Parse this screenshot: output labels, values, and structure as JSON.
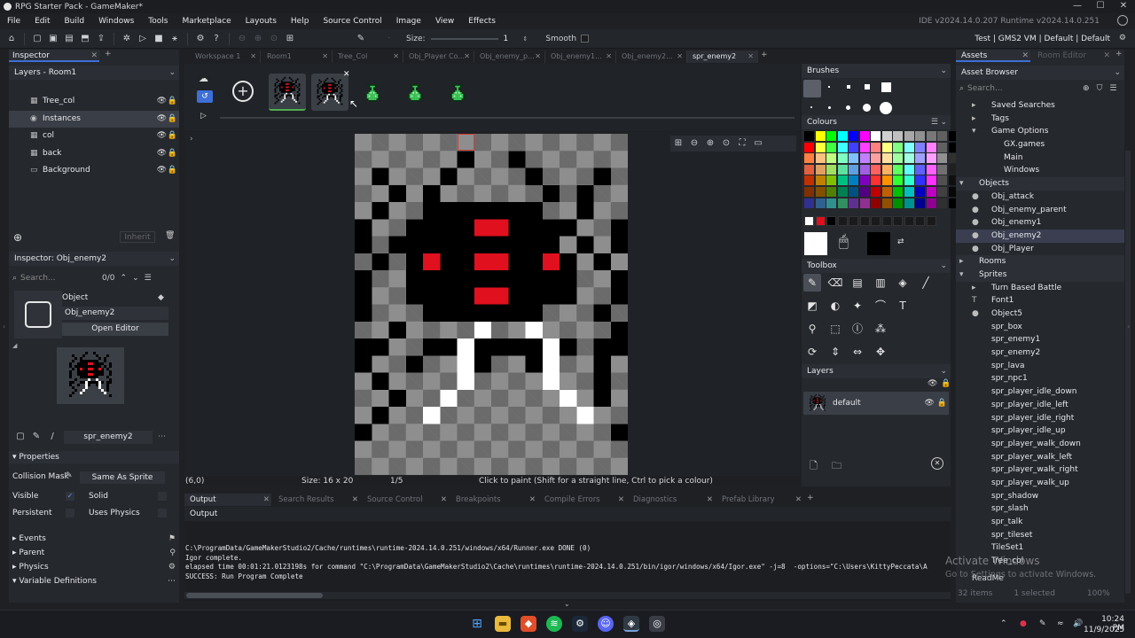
{
  "window": {
    "title": "RPG Starter Pack - GameMaker*",
    "min": "—",
    "max": "☐",
    "close": "✕"
  },
  "menu": {
    "items": [
      "File",
      "Edit",
      "Build",
      "Windows",
      "Tools",
      "Marketplace",
      "Layouts",
      "Help",
      "Source Control",
      "Image",
      "View",
      "Effects"
    ],
    "version": "IDE v2024.14.0.207  Runtime v2024.14.0.251"
  },
  "toolbar": {
    "size_label": "Size:",
    "size_value": "1",
    "smooth_label": "Smooth",
    "config": "Test  |  GMS2 VM  |  Default  |  Default"
  },
  "inspector": {
    "title": "Inspector",
    "layers_header": "Layers - Room1",
    "layers": [
      {
        "name": "Tree_col",
        "icon": "tile-layer-icon",
        "glyph": "▦"
      },
      {
        "name": "Instances",
        "icon": "instance-layer-icon",
        "glyph": "◉"
      },
      {
        "name": "col",
        "icon": "tile-layer-icon",
        "glyph": "▦"
      },
      {
        "name": "back",
        "icon": "tile-layer-icon",
        "glyph": "▦"
      },
      {
        "name": "Background",
        "icon": "background-layer-icon",
        "glyph": "▭"
      }
    ],
    "inherit": "Inherit",
    "obj_header": "Inspector: Obj_enemy2",
    "search_placeholder": "Search...",
    "search_count": "0/0",
    "object_label": "Object",
    "object_name": "Obj_enemy2",
    "open_editor": "Open Editor",
    "sprite_name": "spr_enemy2",
    "properties": "Properties",
    "collision_mask": "Collision Mask",
    "same_as_sprite": "Same As Sprite",
    "visible": "Visible",
    "solid": "Solid",
    "persistent": "Persistent",
    "uses_physics": "Uses Physics",
    "sections": [
      "Events",
      "Parent",
      "Physics",
      "Variable Definitions"
    ]
  },
  "tabs": [
    {
      "label": "Workspace 1",
      "active": false
    },
    {
      "label": "Room1",
      "active": false
    },
    {
      "label": "Tree_Col",
      "active": false
    },
    {
      "label": "Obj_Player Co...",
      "active": false
    },
    {
      "label": "Obj_enemy_p...",
      "active": false
    },
    {
      "label": "Obj_enemy1...",
      "active": false
    },
    {
      "label": "Obj_enemy2...",
      "active": false
    },
    {
      "label": "spr_enemy2",
      "active": true
    }
  ],
  "status": {
    "coords": "(6,0)",
    "size": "Size: 16 x 20",
    "frame": "1/5",
    "hint": "Click to paint (Shift for a straight line, Ctrl to pick a colour)"
  },
  "brushes": {
    "title": "Brushes"
  },
  "colours": {
    "title": "Colours"
  },
  "toolbox": {
    "title": "Toolbox"
  },
  "layers_panel": {
    "title": "Layers",
    "layer": "default"
  },
  "assets": {
    "title": "Assets",
    "room_editor_tab": "Room Editor",
    "browser": "Asset Browser",
    "search_placeholder": "Search...",
    "tree": [
      {
        "label": "Saved Searches",
        "indent": 1,
        "arrow": "▸"
      },
      {
        "label": "Tags",
        "indent": 1,
        "arrow": "▸"
      },
      {
        "label": "Game Options",
        "indent": 1,
        "arrow": "▾"
      },
      {
        "label": "GX.games",
        "indent": 2,
        "arrow": ""
      },
      {
        "label": "Main",
        "indent": 2,
        "arrow": ""
      },
      {
        "label": "Windows",
        "indent": 2,
        "arrow": ""
      },
      {
        "label": "Objects",
        "indent": 0,
        "arrow": "▾",
        "folder": true
      },
      {
        "label": "Obj_attack",
        "indent": 1,
        "arrow": "●"
      },
      {
        "label": "Obj_enemy_parent",
        "indent": 1,
        "arrow": "●"
      },
      {
        "label": "Obj_enemy1",
        "indent": 1,
        "arrow": "●"
      },
      {
        "label": "Obj_enemy2",
        "indent": 1,
        "arrow": "●",
        "selected": true
      },
      {
        "label": "Obj_Player",
        "indent": 1,
        "arrow": "●"
      },
      {
        "label": "Rooms",
        "indent": 0,
        "arrow": "▸",
        "folder": true
      },
      {
        "label": "Sprites",
        "indent": 0,
        "arrow": "▾",
        "folder": true
      },
      {
        "label": "Turn Based Battle",
        "indent": 1,
        "arrow": "▸"
      },
      {
        "label": "Font1",
        "indent": 1,
        "arrow": "T"
      },
      {
        "label": "Object5",
        "indent": 1,
        "arrow": "●"
      },
      {
        "label": "spr_box",
        "indent": 1,
        "arrow": ""
      },
      {
        "label": "spr_enemy1",
        "indent": 1,
        "arrow": ""
      },
      {
        "label": "spr_enemy2",
        "indent": 1,
        "arrow": ""
      },
      {
        "label": "spr_lava",
        "indent": 1,
        "arrow": ""
      },
      {
        "label": "spr_npc1",
        "indent": 1,
        "arrow": ""
      },
      {
        "label": "spr_player_idle_down",
        "indent": 1,
        "arrow": ""
      },
      {
        "label": "spr_player_idle_left",
        "indent": 1,
        "arrow": ""
      },
      {
        "label": "spr_player_idle_right",
        "indent": 1,
        "arrow": ""
      },
      {
        "label": "spr_player_idle_up",
        "indent": 1,
        "arrow": ""
      },
      {
        "label": "spr_player_walk_down",
        "indent": 1,
        "arrow": ""
      },
      {
        "label": "spr_player_walk_left",
        "indent": 1,
        "arrow": ""
      },
      {
        "label": "spr_player_walk_right",
        "indent": 1,
        "arrow": ""
      },
      {
        "label": "spr_player_walk_up",
        "indent": 1,
        "arrow": ""
      },
      {
        "label": "spr_shadow",
        "indent": 1,
        "arrow": ""
      },
      {
        "label": "spr_slash",
        "indent": 1,
        "arrow": ""
      },
      {
        "label": "spr_talk",
        "indent": 1,
        "arrow": ""
      },
      {
        "label": "spr_tileset",
        "indent": 1,
        "arrow": ""
      },
      {
        "label": "TileSet1",
        "indent": 1,
        "arrow": ""
      },
      {
        "label": "Tree_col",
        "indent": 1,
        "arrow": ""
      }
    ],
    "footer_items": "32 items",
    "footer_selected": "1 selected",
    "footer_zoom": "100%",
    "readme": "ReadMe"
  },
  "output": {
    "tabs": [
      "Output",
      "Search Results",
      "Source Control",
      "Breakpoints",
      "Compile Errors",
      "Diagnostics",
      "Prefab Library"
    ],
    "label": "Output",
    "lines": [
      "C:\\ProgramData/GameMakerStudio2/Cache/runtimes\\runtime-2024.14.0.251/windows/x64/Runner.exe DONE (0)",
      "Igor complete.",
      "elapsed time 00:01:21.0123198s for command \"C:\\ProgramData\\GameMakerStudio2\\Cache\\runtimes\\runtime-2024.14.0.251/bin/igor/windows/x64/Igor.exe\" -j=8  -options=\"C:\\Users\\KittyPeccata\\A",
      "SUCCESS: Run Program Complete"
    ]
  },
  "watermark": {
    "line1": "Activate Windows",
    "line2": "Go to Settings to activate Windows."
  },
  "taskbar": {
    "time": "10:24 PM",
    "date": "11/9/2025"
  },
  "colors": {
    "accent": "#3d6fd6",
    "selection": "#3a3e46",
    "enemy_red": "#e0101e"
  }
}
